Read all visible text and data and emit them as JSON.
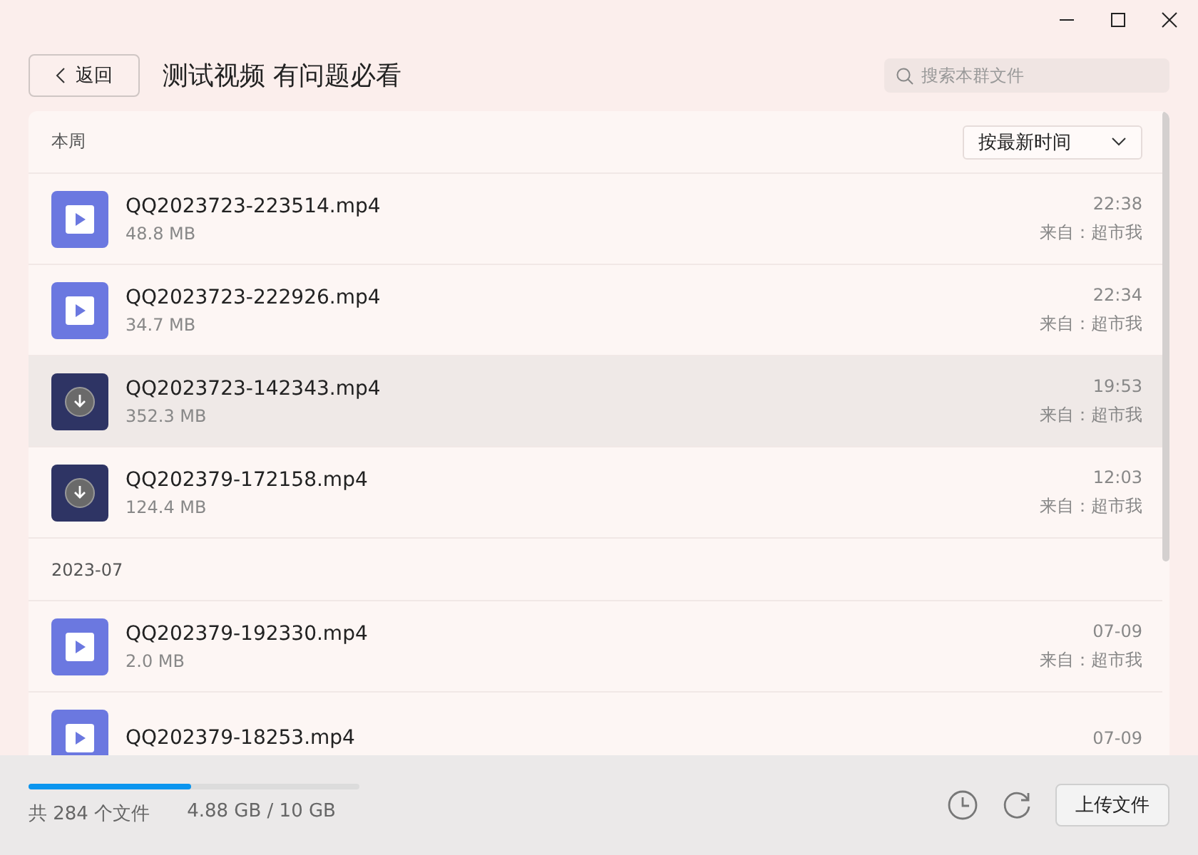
{
  "header": {
    "back_label": "返回",
    "title": "测试视频 有问题必看",
    "search": {
      "placeholder": "搜索本群文件"
    }
  },
  "sort": {
    "label": "按最新时间"
  },
  "sections": [
    {
      "label": "本周",
      "files": [
        {
          "name": "QQ2023723-223514.mp4",
          "size": "48.8 MB",
          "time": "22:38",
          "source": "来自：超市我",
          "kind": "video",
          "selected": false
        },
        {
          "name": "QQ2023723-222926.mp4",
          "size": "34.7 MB",
          "time": "22:34",
          "source": "来自：超市我",
          "kind": "video",
          "selected": false
        },
        {
          "name": "QQ2023723-142343.mp4",
          "size": "352.3 MB",
          "time": "19:53",
          "source": "来自：超市我",
          "kind": "download",
          "selected": true
        },
        {
          "name": "QQ202379-172158.mp4",
          "size": "124.4 MB",
          "time": "12:03",
          "source": "来自：超市我",
          "kind": "download",
          "selected": false
        }
      ]
    },
    {
      "label": "2023-07",
      "files": [
        {
          "name": "QQ202379-192330.mp4",
          "size": "2.0 MB",
          "time": "07-09",
          "source": "来自：超市我",
          "kind": "video",
          "selected": false
        },
        {
          "name": "QQ202379-18253.mp4",
          "time": "07-09",
          "kind": "video",
          "selected": false
        }
      ]
    }
  ],
  "footer": {
    "storage": {
      "level": 0.49
    },
    "count": "共 284 个文件",
    "usage": "4.88 GB / 10 GB",
    "upload_label": "上传文件"
  }
}
